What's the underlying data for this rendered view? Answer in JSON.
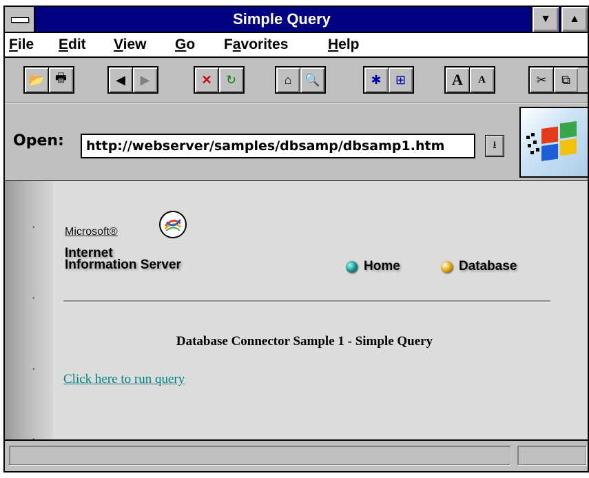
{
  "window": {
    "title": "Simple Query"
  },
  "menu": [
    "File",
    "Edit",
    "View",
    "Go",
    "Favorites",
    "Help"
  ],
  "menu_accel": [
    "F",
    "E",
    "V",
    "G",
    "a",
    "H"
  ],
  "address": {
    "label": "Open:",
    "url": "http://webserver/samples/dbsamp/dbsamp1.htm"
  },
  "toolbar": {
    "groups": [
      [
        "open-icon",
        "print-icon"
      ],
      [
        "back-icon",
        "forward-icon"
      ],
      [
        "stop-icon",
        "refresh-icon"
      ],
      [
        "home-icon",
        "search-icon"
      ],
      [
        "favorites-icon",
        "add-favorite-icon"
      ],
      [
        "larger-font-icon",
        "smaller-font-icon"
      ],
      [
        "cut-icon",
        "copy-icon"
      ]
    ]
  },
  "page": {
    "brand_small": "Microsoft®",
    "brand_line1": "Internet",
    "brand_line2": "Information Server",
    "nav_home": "Home",
    "nav_database": "Database",
    "heading": "Database Connector Sample 1 - Simple Query",
    "run_link": "Click here to run query"
  },
  "status": {
    "text": ""
  },
  "colors": {
    "titlebar": "#000080",
    "link": "#008080",
    "content_bg": "#dcdcdc"
  }
}
